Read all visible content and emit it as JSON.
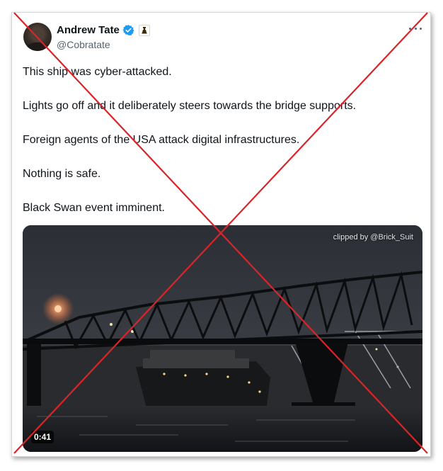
{
  "tweet": {
    "author": {
      "display_name": "Andrew Tate",
      "handle": "@Cobratate",
      "verified": true,
      "badge_icon": "chess-piece-icon"
    },
    "more_icon": "more-options-icon",
    "text_lines": [
      "This ship was cyber-attacked.",
      "Lights go off and it deliberately steers towards the bridge supports.",
      "Foreign agents of the USA attack digital infrastructures.",
      "Nothing is safe.",
      "Black Swan event imminent."
    ],
    "media": {
      "watermark": "clipped by @Brick_Suit",
      "duration": "0:41"
    }
  },
  "overlay": {
    "type": "red-cross",
    "color": "#d9252a"
  },
  "colors": {
    "text": "#0f1419",
    "secondary": "#536471",
    "verified": "#1d9bf0"
  }
}
